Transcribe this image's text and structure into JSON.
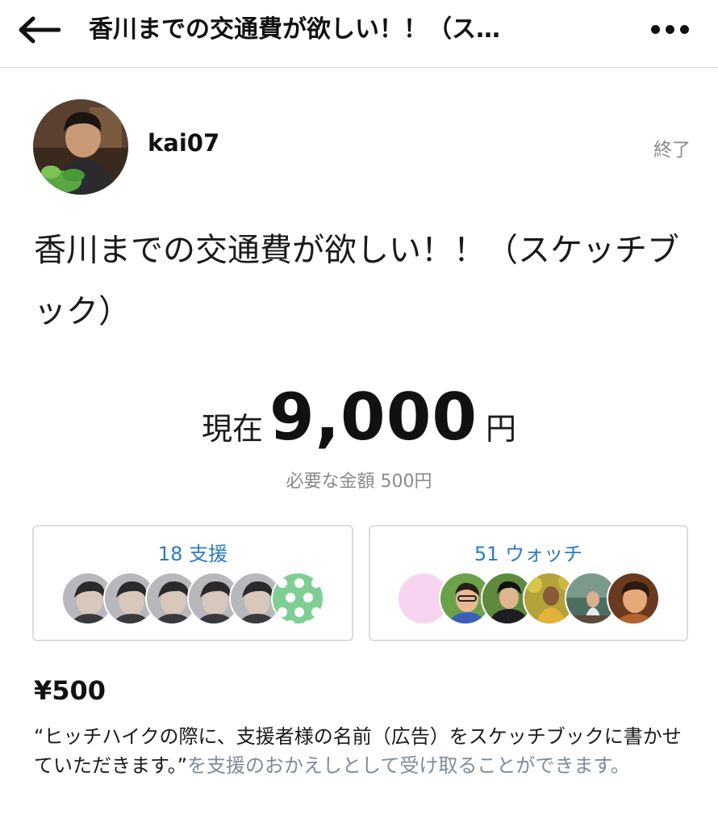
{
  "header": {
    "back_icon": "arrow-left-icon",
    "title": "香川までの交通費が欲しい！！（ス…",
    "more_icon": "more-dots-icon"
  },
  "owner": {
    "username": "kai07",
    "status": "終了"
  },
  "project": {
    "title": "香川までの交通費が欲しい！！（スケッチブック）"
  },
  "funding": {
    "current_prefix": "現在",
    "current_amount": "9,000",
    "current_unit": "円",
    "required_text": "必要な金額 500円"
  },
  "supporters": {
    "label": "18 支援"
  },
  "watchers": {
    "label": "51 ウォッチ"
  },
  "reward": {
    "price": "¥500",
    "desc_main": "“ヒッチハイクの際に、支援者様の名前（広告）をスケッチブックに書かせていただきます。”",
    "desc_suffix": "を支援のおかえしとして受け取ることができます。"
  },
  "colors": {
    "accent_blue": "#2a7bc4",
    "muted_grey": "#8a8a8a",
    "border": "#dcdcdc"
  }
}
